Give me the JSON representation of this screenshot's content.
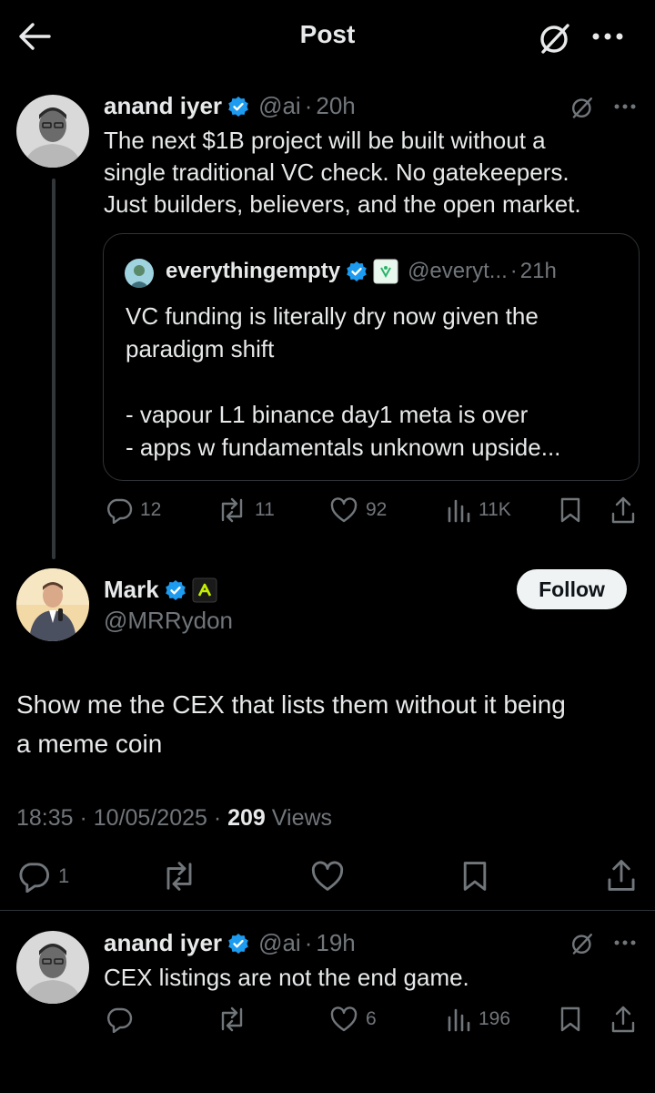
{
  "header": {
    "title": "Post"
  },
  "thread_post": {
    "name": "anand iyer",
    "handle": "@ai",
    "time": "20h",
    "text": "The next $1B project will be built without a\nsingle traditional VC check. No gatekeepers.\nJust builders, believers, and the open market.",
    "quote": {
      "name": "everythingempty",
      "handle": "@everyt...",
      "time": "21h",
      "text": "VC funding is literally dry now given the\nparadigm shift\n\n- vapour L1 binance day1 meta is over\n- apps w fundamentals unknown upside..."
    },
    "actions": {
      "replies": "12",
      "reposts": "11",
      "likes": "92",
      "views": "11K"
    }
  },
  "main_post": {
    "name": "Mark",
    "handle": "@MRRydon",
    "follow_label": "Follow",
    "text": "Show me the CEX that lists them without it being\na meme coin",
    "timestamp": "18:35 · 10/05/2025 · ",
    "views_count": "209",
    "views_label": " Views",
    "actions": {
      "replies": "1"
    }
  },
  "reply_post": {
    "name": "anand iyer",
    "handle": "@ai",
    "time": "19h",
    "text": "CEX listings are not the end game.",
    "actions": {
      "likes": "6",
      "views": "196"
    }
  },
  "colors": {
    "verified": "#1d9bf0",
    "background": "#000000",
    "muted": "#71767b"
  },
  "icons": [
    "back-arrow-icon",
    "grok-icon",
    "more-icon",
    "verified-icon",
    "reply-icon",
    "repost-icon",
    "like-icon",
    "views-icon",
    "bookmark-icon",
    "share-icon"
  ]
}
